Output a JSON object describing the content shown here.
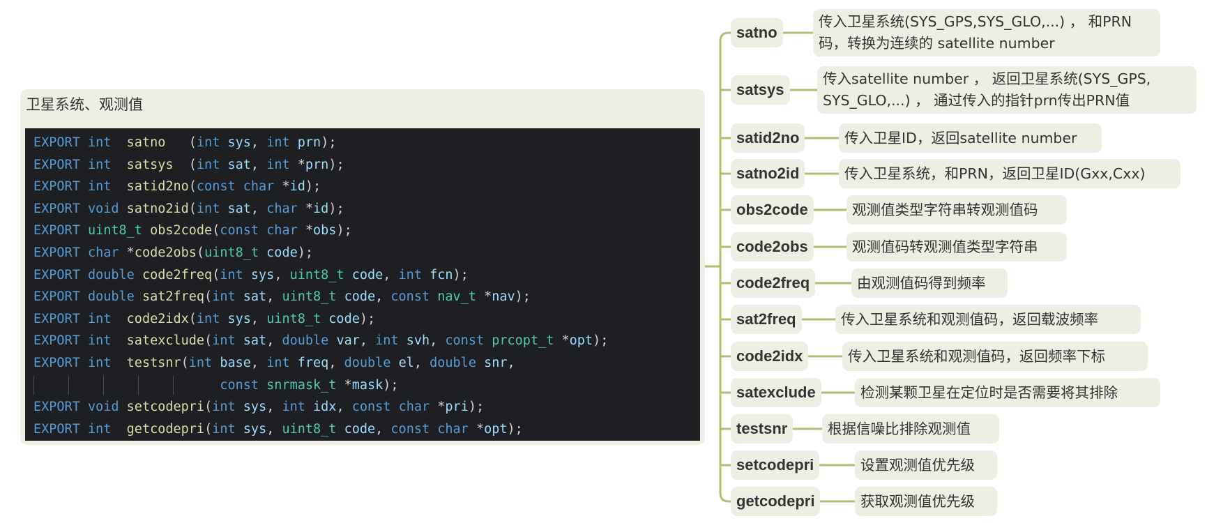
{
  "root": {
    "title": "卫星系统、观测值"
  },
  "code_lines": [
    [
      [
        "kw",
        "EXPORT"
      ],
      [
        "pn",
        " "
      ],
      [
        "kw",
        "int"
      ],
      [
        "pn",
        "  "
      ],
      [
        "fn",
        "satno"
      ],
      [
        "pn",
        "   "
      ],
      [
        "pn",
        "("
      ],
      [
        "kw",
        "int"
      ],
      [
        "pn",
        " "
      ],
      [
        "par",
        "sys"
      ],
      [
        "pn",
        ", "
      ],
      [
        "kw",
        "int"
      ],
      [
        "pn",
        " "
      ],
      [
        "par",
        "prn"
      ],
      [
        "pn",
        ");"
      ]
    ],
    [
      [
        "kw",
        "EXPORT"
      ],
      [
        "pn",
        " "
      ],
      [
        "kw",
        "int"
      ],
      [
        "pn",
        "  "
      ],
      [
        "fn",
        "satsys"
      ],
      [
        "pn",
        "  "
      ],
      [
        "pn",
        "("
      ],
      [
        "kw",
        "int"
      ],
      [
        "pn",
        " "
      ],
      [
        "par",
        "sat"
      ],
      [
        "pn",
        ", "
      ],
      [
        "kw",
        "int"
      ],
      [
        "pn",
        " "
      ],
      [
        "op",
        "*"
      ],
      [
        "par",
        "prn"
      ],
      [
        "pn",
        ");"
      ]
    ],
    [
      [
        "kw",
        "EXPORT"
      ],
      [
        "pn",
        " "
      ],
      [
        "kw",
        "int"
      ],
      [
        "pn",
        "  "
      ],
      [
        "fn",
        "satid2no"
      ],
      [
        "pn",
        "("
      ],
      [
        "kw",
        "const"
      ],
      [
        "pn",
        " "
      ],
      [
        "kw",
        "char"
      ],
      [
        "pn",
        " "
      ],
      [
        "op",
        "*"
      ],
      [
        "par",
        "id"
      ],
      [
        "pn",
        ");"
      ]
    ],
    [
      [
        "kw",
        "EXPORT"
      ],
      [
        "pn",
        " "
      ],
      [
        "kw",
        "void"
      ],
      [
        "pn",
        " "
      ],
      [
        "fn",
        "satno2id"
      ],
      [
        "pn",
        "("
      ],
      [
        "kw",
        "int"
      ],
      [
        "pn",
        " "
      ],
      [
        "par",
        "sat"
      ],
      [
        "pn",
        ", "
      ],
      [
        "kw",
        "char"
      ],
      [
        "pn",
        " "
      ],
      [
        "op",
        "*"
      ],
      [
        "par",
        "id"
      ],
      [
        "pn",
        ");"
      ]
    ],
    [
      [
        "kw",
        "EXPORT"
      ],
      [
        "pn",
        " "
      ],
      [
        "type",
        "uint8_t"
      ],
      [
        "pn",
        " "
      ],
      [
        "fn",
        "obs2code"
      ],
      [
        "pn",
        "("
      ],
      [
        "kw",
        "const"
      ],
      [
        "pn",
        " "
      ],
      [
        "kw",
        "char"
      ],
      [
        "pn",
        " "
      ],
      [
        "op",
        "*"
      ],
      [
        "par",
        "obs"
      ],
      [
        "pn",
        ");"
      ]
    ],
    [
      [
        "kw",
        "EXPORT"
      ],
      [
        "pn",
        " "
      ],
      [
        "kw",
        "char"
      ],
      [
        "pn",
        " "
      ],
      [
        "op",
        "*"
      ],
      [
        "fn",
        "code2obs"
      ],
      [
        "pn",
        "("
      ],
      [
        "type",
        "uint8_t"
      ],
      [
        "pn",
        " "
      ],
      [
        "par",
        "code"
      ],
      [
        "pn",
        ");"
      ]
    ],
    [
      [
        "kw",
        "EXPORT"
      ],
      [
        "pn",
        " "
      ],
      [
        "kw",
        "double"
      ],
      [
        "pn",
        " "
      ],
      [
        "fn",
        "code2freq"
      ],
      [
        "pn",
        "("
      ],
      [
        "kw",
        "int"
      ],
      [
        "pn",
        " "
      ],
      [
        "par",
        "sys"
      ],
      [
        "pn",
        ", "
      ],
      [
        "type",
        "uint8_t"
      ],
      [
        "pn",
        " "
      ],
      [
        "par",
        "code"
      ],
      [
        "pn",
        ", "
      ],
      [
        "kw",
        "int"
      ],
      [
        "pn",
        " "
      ],
      [
        "par",
        "fcn"
      ],
      [
        "pn",
        ");"
      ]
    ],
    [
      [
        "kw",
        "EXPORT"
      ],
      [
        "pn",
        " "
      ],
      [
        "kw",
        "double"
      ],
      [
        "pn",
        " "
      ],
      [
        "fn",
        "sat2freq"
      ],
      [
        "pn",
        "("
      ],
      [
        "kw",
        "int"
      ],
      [
        "pn",
        " "
      ],
      [
        "par",
        "sat"
      ],
      [
        "pn",
        ", "
      ],
      [
        "type",
        "uint8_t"
      ],
      [
        "pn",
        " "
      ],
      [
        "par",
        "code"
      ],
      [
        "pn",
        ", "
      ],
      [
        "kw",
        "const"
      ],
      [
        "pn",
        " "
      ],
      [
        "type",
        "nav_t"
      ],
      [
        "pn",
        " "
      ],
      [
        "op",
        "*"
      ],
      [
        "par",
        "nav"
      ],
      [
        "pn",
        ");"
      ]
    ],
    [
      [
        "kw",
        "EXPORT"
      ],
      [
        "pn",
        " "
      ],
      [
        "kw",
        "int"
      ],
      [
        "pn",
        "  "
      ],
      [
        "fn",
        "code2idx"
      ],
      [
        "pn",
        "("
      ],
      [
        "kw",
        "int"
      ],
      [
        "pn",
        " "
      ],
      [
        "par",
        "sys"
      ],
      [
        "pn",
        ", "
      ],
      [
        "type",
        "uint8_t"
      ],
      [
        "pn",
        " "
      ],
      [
        "par",
        "code"
      ],
      [
        "pn",
        ");"
      ]
    ],
    [
      [
        "kw",
        "EXPORT"
      ],
      [
        "pn",
        " "
      ],
      [
        "kw",
        "int"
      ],
      [
        "pn",
        "  "
      ],
      [
        "fn",
        "satexclude"
      ],
      [
        "pn",
        "("
      ],
      [
        "kw",
        "int"
      ],
      [
        "pn",
        " "
      ],
      [
        "par",
        "sat"
      ],
      [
        "pn",
        ", "
      ],
      [
        "kw",
        "double"
      ],
      [
        "pn",
        " "
      ],
      [
        "par",
        "var"
      ],
      [
        "pn",
        ", "
      ],
      [
        "kw",
        "int"
      ],
      [
        "pn",
        " "
      ],
      [
        "par",
        "svh"
      ],
      [
        "pn",
        ", "
      ],
      [
        "kw",
        "const"
      ],
      [
        "pn",
        " "
      ],
      [
        "type",
        "prcopt_t"
      ],
      [
        "pn",
        " "
      ],
      [
        "op",
        "*"
      ],
      [
        "par",
        "opt"
      ],
      [
        "pn",
        ");"
      ]
    ],
    [
      [
        "kw",
        "EXPORT"
      ],
      [
        "pn",
        " "
      ],
      [
        "kw",
        "int"
      ],
      [
        "pn",
        "  "
      ],
      [
        "fn",
        "testsnr"
      ],
      [
        "pn",
        "("
      ],
      [
        "kw",
        "int"
      ],
      [
        "pn",
        " "
      ],
      [
        "par",
        "base"
      ],
      [
        "pn",
        ", "
      ],
      [
        "kw",
        "int"
      ],
      [
        "pn",
        " "
      ],
      [
        "par",
        "freq"
      ],
      [
        "pn",
        ", "
      ],
      [
        "kw",
        "double"
      ],
      [
        "pn",
        " "
      ],
      [
        "par",
        "el"
      ],
      [
        "pn",
        ", "
      ],
      [
        "kw",
        "double"
      ],
      [
        "pn",
        " "
      ],
      [
        "par",
        "snr"
      ],
      [
        "pn",
        ","
      ]
    ],
    [
      [
        "pn",
        "                        "
      ],
      [
        "kw",
        "const"
      ],
      [
        "pn",
        " "
      ],
      [
        "type",
        "snrmask_t"
      ],
      [
        "pn",
        " "
      ],
      [
        "op",
        "*"
      ],
      [
        "par",
        "mask"
      ],
      [
        "pn",
        ");"
      ]
    ],
    [
      [
        "kw",
        "EXPORT"
      ],
      [
        "pn",
        " "
      ],
      [
        "kw",
        "void"
      ],
      [
        "pn",
        " "
      ],
      [
        "fn",
        "setcodepri"
      ],
      [
        "pn",
        "("
      ],
      [
        "kw",
        "int"
      ],
      [
        "pn",
        " "
      ],
      [
        "par",
        "sys"
      ],
      [
        "pn",
        ", "
      ],
      [
        "kw",
        "int"
      ],
      [
        "pn",
        " "
      ],
      [
        "par",
        "idx"
      ],
      [
        "pn",
        ", "
      ],
      [
        "kw",
        "const"
      ],
      [
        "pn",
        " "
      ],
      [
        "kw",
        "char"
      ],
      [
        "pn",
        " "
      ],
      [
        "op",
        "*"
      ],
      [
        "par",
        "pri"
      ],
      [
        "pn",
        ");"
      ]
    ],
    [
      [
        "kw",
        "EXPORT"
      ],
      [
        "pn",
        " "
      ],
      [
        "kw",
        "int"
      ],
      [
        "pn",
        "  "
      ],
      [
        "fn",
        "getcodepri"
      ],
      [
        "pn",
        "("
      ],
      [
        "kw",
        "int"
      ],
      [
        "pn",
        " "
      ],
      [
        "par",
        "sys"
      ],
      [
        "pn",
        ", "
      ],
      [
        "type",
        "uint8_t"
      ],
      [
        "pn",
        " "
      ],
      [
        "par",
        "code"
      ],
      [
        "pn",
        ", "
      ],
      [
        "kw",
        "const"
      ],
      [
        "pn",
        " "
      ],
      [
        "kw",
        "char"
      ],
      [
        "pn",
        " "
      ],
      [
        "op",
        "*"
      ],
      [
        "par",
        "opt"
      ],
      [
        "pn",
        ");"
      ]
    ]
  ],
  "functions": [
    {
      "name": "satno",
      "desc": "传入卫星系统(SYS_GPS,SYS_GLO,...) ， 和PRN码，转换为连续的 satellite number"
    },
    {
      "name": "satsys",
      "desc": "传入satellite number ， 返回卫星系统(SYS_GPS, SYS_GLO,...) ， 通过传入的指针prn传出PRN值"
    },
    {
      "name": "satid2no",
      "desc": "传入卫星ID，返回satellite number"
    },
    {
      "name": "satno2id",
      "desc": "传入卫星系统，和PRN，返回卫星ID(Gxx,Cxx)"
    },
    {
      "name": "obs2code",
      "desc": "观测值类型字符串转观测值码"
    },
    {
      "name": "code2obs",
      "desc": "观测值码转观测值类型字符串"
    },
    {
      "name": "code2freq",
      "desc": "由观测值码得到频率"
    },
    {
      "name": "sat2freq",
      "desc": "传入卫星系统和观测值码，返回载波频率"
    },
    {
      "name": "code2idx",
      "desc": "传入卫星系统和观测值码，返回频率下标"
    },
    {
      "name": "satexclude",
      "desc": "检测某颗卫星在定位时是否需要将其排除"
    },
    {
      "name": "testsnr",
      "desc": "根据信噪比排除观测值"
    },
    {
      "name": "setcodepri",
      "desc": "设置观测值优先级"
    },
    {
      "name": "getcodepri",
      "desc": "获取观测值优先级"
    }
  ],
  "colors": {
    "connector": "#b5bb72",
    "card_bg": "#eeefe4",
    "code_bg": "#1e1f22"
  }
}
